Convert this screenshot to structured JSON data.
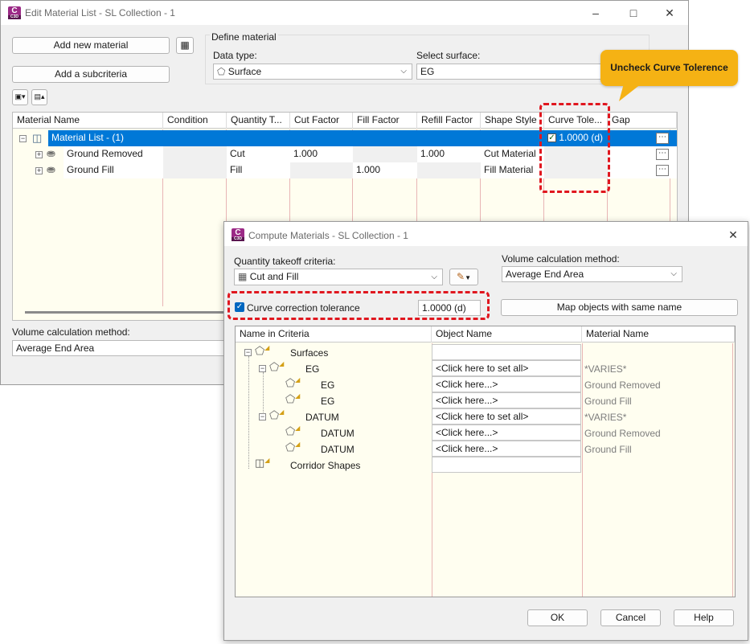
{
  "edit_window": {
    "title": "Edit Material List - SL Collection - 1",
    "icon_label": "C",
    "icon_sub": "C3D",
    "add_new_material": "Add new material",
    "add_subcriteria": "Add a subcriteria",
    "define_material_label": "Define material",
    "data_type_label": "Data type:",
    "data_type_value": "Surface",
    "select_surface_label": "Select surface:",
    "select_surface_value": "EG",
    "columns": [
      "Material Name",
      "Condition",
      "Quantity T...",
      "Cut Factor",
      "Fill Factor",
      "Refill Factor",
      "Shape Style",
      "Curve Tole...",
      "Gap"
    ],
    "rows": [
      {
        "name": "Material List - (1)",
        "condition": "",
        "quantity": "",
        "cut": "",
        "fill": "",
        "refill": "",
        "shape": "",
        "curve": "1.0000 (d)"
      },
      {
        "name": "Ground Removed",
        "condition": "",
        "quantity": "Cut",
        "cut": "1.000",
        "fill": "",
        "refill": "1.000",
        "shape": "Cut Material",
        "curve": ""
      },
      {
        "name": "Ground Fill",
        "condition": "",
        "quantity": "Fill",
        "cut": "",
        "fill": "1.000",
        "refill": "",
        "shape": "Fill Material",
        "curve": ""
      }
    ],
    "volume_calc_label": "Volume calculation method:",
    "volume_calc_value": "Average End Area"
  },
  "callout": {
    "text": "Uncheck Curve Tolerence",
    "color": "#f5b214"
  },
  "compute_window": {
    "title": "Compute Materials - SL Collection - 1",
    "icon_label": "C",
    "icon_sub": "C3D",
    "qty_takeoff_label": "Quantity takeoff criteria:",
    "qty_takeoff_value": "Cut and Fill",
    "volume_calc_label": "Volume calculation method:",
    "volume_calc_value": "Average End Area",
    "curve_correction_label": "Curve correction tolerance",
    "curve_correction_checked": true,
    "curve_correction_value": "1.0000 (d)",
    "map_objects_button": "Map objects with same name",
    "columns": [
      "Name in Criteria",
      "Object Name",
      "Material Name"
    ],
    "tree": [
      {
        "name": "Surfaces",
        "object": "",
        "material": ""
      },
      {
        "name": "EG",
        "object": "<Click here to set all>",
        "material": "*VARIES*"
      },
      {
        "name": "EG",
        "object": "<Click here...>",
        "material": "Ground Removed"
      },
      {
        "name": "EG",
        "object": "<Click here...>",
        "material": "Ground Fill"
      },
      {
        "name": "DATUM",
        "object": "<Click here to set all>",
        "material": "*VARIES*"
      },
      {
        "name": "DATUM",
        "object": "<Click here...>",
        "material": "Ground Removed"
      },
      {
        "name": "DATUM",
        "object": "<Click here...>",
        "material": "Ground Fill"
      },
      {
        "name": "Corridor Shapes",
        "object": "",
        "material": ""
      }
    ],
    "ok_button": "OK",
    "cancel_button": "Cancel",
    "help_button": "Help"
  },
  "colors": {
    "selection_blue": "#0078d7",
    "highlight_red": "#e0171f",
    "grid_background": "#fffef0",
    "autocad_purple": "#9b2a86"
  }
}
